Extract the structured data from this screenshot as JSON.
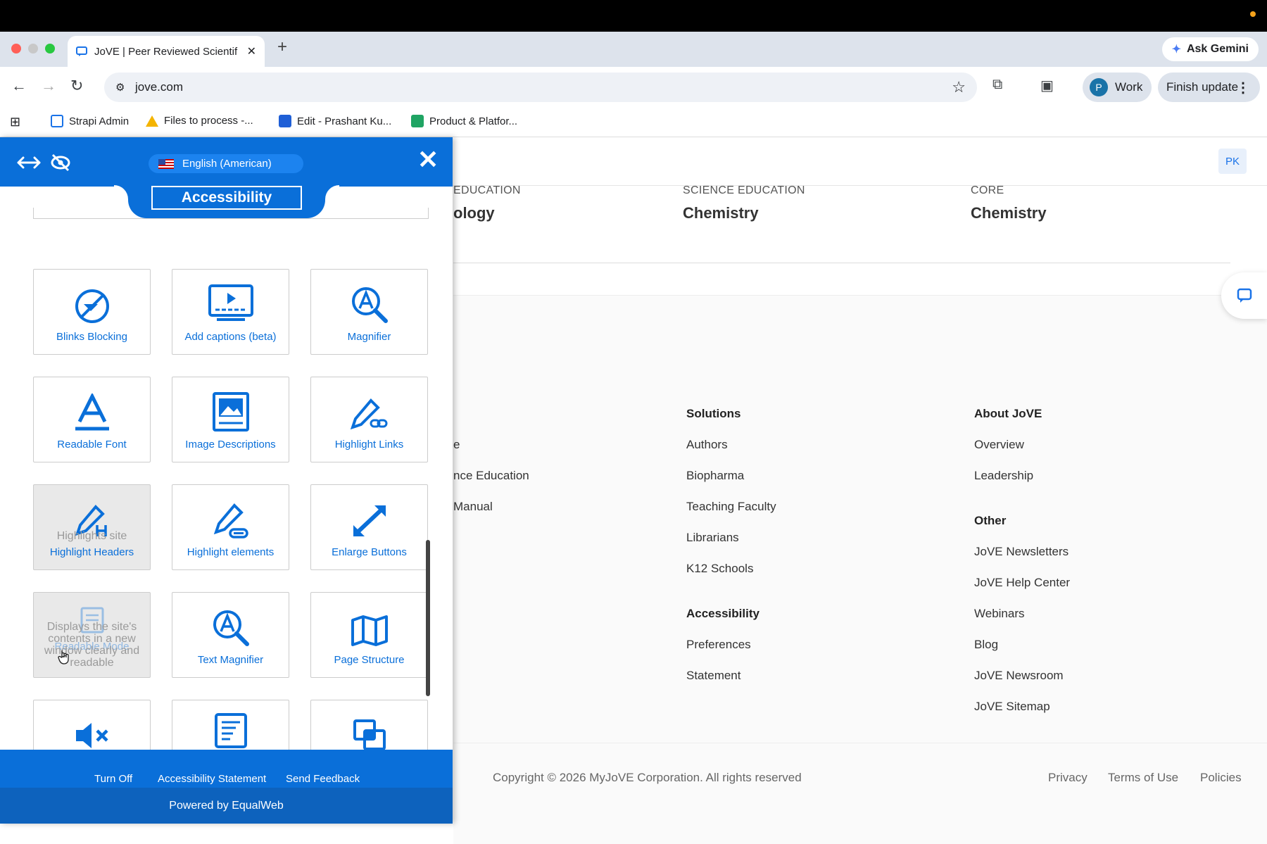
{
  "browser": {
    "tab_title": "JoVE | Peer Reviewed Scientif",
    "new_tab": "+",
    "gemini_label": "Ask Gemini",
    "url": "jove.com",
    "profile_initial": "P",
    "profile_label": "Work",
    "finish_update": "Finish update",
    "bookmarks": [
      "Strapi Admin",
      "Files to process -...",
      "Edit - Prashant Ku...",
      "Product & Platfor..."
    ]
  },
  "site": {
    "user_initials": "PK",
    "categories": [
      {
        "label": "EDUCATION",
        "value": "ology"
      },
      {
        "label": "SCIENCE EDUCATION",
        "value": "Chemistry"
      },
      {
        "label": "CORE",
        "value": "Chemistry"
      }
    ],
    "footer": {
      "col1_items": [
        "e",
        "nce Education",
        "Manual"
      ],
      "solutions_heading": "Solutions",
      "solutions": [
        "Authors",
        "Biopharma",
        "Teaching Faculty",
        "Librarians",
        "K12 Schools"
      ],
      "accessibility_heading": "Accessibility",
      "accessibility": [
        "Preferences",
        "Statement"
      ],
      "about_heading": "About JoVE",
      "about": [
        "Overview",
        "Leadership"
      ],
      "other_heading": "Other",
      "other": [
        "JoVE Newsletters",
        "JoVE Help Center",
        "Webinars",
        "Blog",
        "JoVE Newsroom",
        "JoVE Sitemap"
      ],
      "copyright": "Copyright © 2026 MyJoVE Corporation. All rights reserved",
      "privacy": "Privacy",
      "terms": "Terms of Use",
      "policies": "Policies"
    }
  },
  "panel": {
    "language": "English (American)",
    "title": "Accessibility",
    "close": "✕",
    "cards": [
      {
        "label": "Blinks Blocking",
        "icon": "blinks-blocking-icon"
      },
      {
        "label": "Add captions (beta)",
        "icon": "captions-icon"
      },
      {
        "label": "Magnifier",
        "icon": "magnifier-icon"
      },
      {
        "label": "Readable Font",
        "icon": "readable-font-icon"
      },
      {
        "label": "Image Descriptions",
        "icon": "image-descriptions-icon"
      },
      {
        "label": "Highlight Links",
        "icon": "highlight-links-icon"
      },
      {
        "label": "Highlight Headers",
        "icon": "highlight-headers-icon",
        "tooltip": "Highlights site"
      },
      {
        "label": "Highlight elements",
        "icon": "highlight-elements-icon"
      },
      {
        "label": "Enlarge Buttons",
        "icon": "enlarge-buttons-icon"
      },
      {
        "label": "Readable Mode",
        "icon": "readable-mode-icon",
        "tooltip": "Displays the site's contents in a new window clearly and readable"
      },
      {
        "label": "Text Magnifier",
        "icon": "text-magnifier-icon"
      },
      {
        "label": "Page Structure",
        "icon": "page-structure-icon"
      }
    ],
    "footer_links": [
      "Turn Off",
      "Accessibility Statement",
      "Send Feedback"
    ],
    "powered_by": "Powered by EqualWeb",
    "colors": {
      "primary": "#0a6fd9",
      "accent": "#1c83ef"
    }
  }
}
